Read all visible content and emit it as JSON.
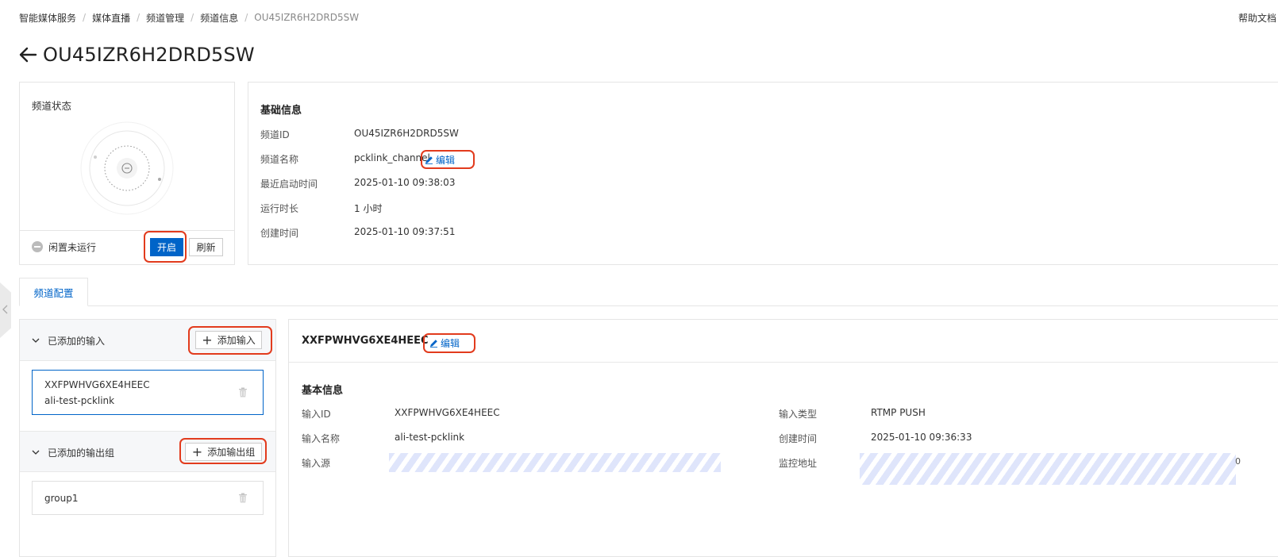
{
  "breadcrumb": [
    "智能媒体服务",
    "媒体直播",
    "频道管理",
    "频道信息",
    "OU45IZR6H2DRD5SW"
  ],
  "header": {
    "help_link": "帮助文档"
  },
  "page_title": "OU45IZR6H2DRD5SW",
  "status_card": {
    "title": "频道状态",
    "state_text": "闲置未运行",
    "start_button": "开启",
    "refresh_button": "刷新"
  },
  "basic_info": {
    "title": "基础信息",
    "channel_id_label": "频道ID",
    "channel_id": "OU45IZR6H2DRD5SW",
    "channel_name_label": "频道名称",
    "channel_name": "pcklink_channel",
    "edit_label": "编辑",
    "last_start_label": "最近启动时间",
    "last_start": "2025-01-10 09:38:03",
    "run_duration_label": "运行时长",
    "run_duration": "1 小时",
    "created_label": "创建时间",
    "created": "2025-01-10 09:37:51"
  },
  "tabs": {
    "active": "频道配置"
  },
  "inputs_group": {
    "title": "已添加的输入",
    "add_button": "添加输入",
    "item_id": "XXFPWHVG6XE4HEEC",
    "item_name": "ali-test-pcklink"
  },
  "outputs_group": {
    "title": "已添加的输出组",
    "add_button": "添加输出组",
    "item_name": "group1"
  },
  "input_detail": {
    "header_id": "XXFPWHVG6XE4HEEC",
    "edit_label": "编辑",
    "section_title": "基本信息",
    "input_id_label": "输入ID",
    "input_id": "XXFPWHVG6XE4HEEC",
    "input_name_label": "输入名称",
    "input_name": "ali-test-pcklink",
    "input_source_label": "输入源",
    "input_type_label": "输入类型",
    "input_type": "RTMP PUSH",
    "created_label": "创建时间",
    "created": "2025-01-10 09:36:33",
    "monitor_label": "监控地址",
    "monitor_tail": "0"
  },
  "colors": {
    "primary": "#0064c8",
    "highlight_box": "#e23b1d",
    "masked": "#dfe5fb"
  }
}
